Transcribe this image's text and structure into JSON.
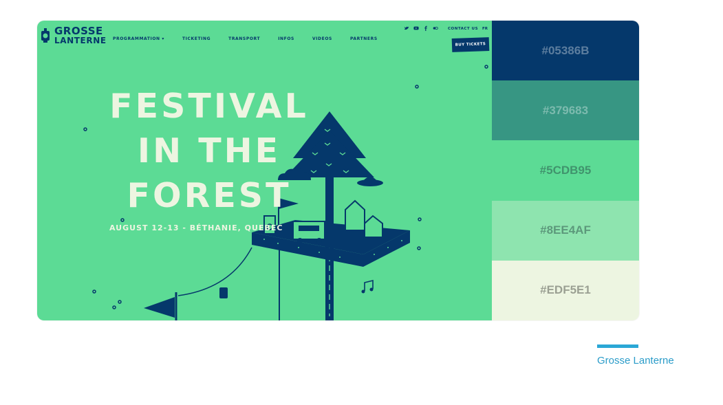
{
  "site": {
    "logo_line1": "GROSSE",
    "logo_line2": "LANTERNE",
    "nav": [
      "PROGRAMMATION",
      "TICKETING",
      "TRANSPORT",
      "INFOS",
      "VIDEOS",
      "PARTNERS"
    ],
    "contact_label": "CONTACT US",
    "lang_label": "FR",
    "buy_label": "BUY TICKETS",
    "hero_line1": "FESTIVAL",
    "hero_line2": "IN THE",
    "hero_line3": "FOREST",
    "date_text": "AUGUST 12-13 - BÉTHANIE, QUEBEC",
    "social_icons": [
      "twitter-icon",
      "youtube-icon",
      "facebook-icon",
      "flickr-icon"
    ]
  },
  "palette": [
    {
      "hex": "#05386B",
      "label": "#05386B"
    },
    {
      "hex": "#379683",
      "label": "#379683"
    },
    {
      "hex": "#5CDB95",
      "label": "#5CDB95"
    },
    {
      "hex": "#8EE4AF",
      "label": "#8EE4AF"
    },
    {
      "hex": "#EDF5E1",
      "label": "#EDF5E1"
    }
  ],
  "caption": {
    "title": "Grosse Lanterne",
    "accent_color": "#2BA7D6"
  }
}
